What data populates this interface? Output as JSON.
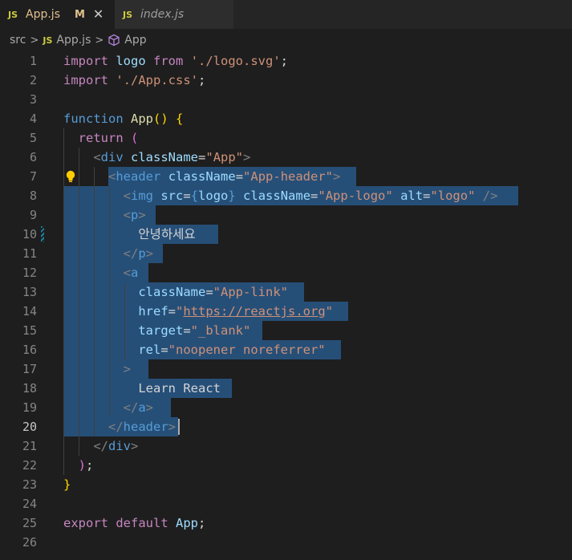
{
  "tabs": [
    {
      "icon": "JS",
      "label": "App.js",
      "modified": "M",
      "close": "✕"
    },
    {
      "icon": "JS",
      "label": "index.js"
    }
  ],
  "breadcrumb": {
    "folder": "src",
    "file_icon": "JS",
    "file": "App.js",
    "symbol": "App",
    "sep": ">"
  },
  "editor": {
    "line_numbers": [
      "1",
      "2",
      "3",
      "4",
      "5",
      "6",
      "7",
      "8",
      "9",
      "10",
      "11",
      "12",
      "13",
      "14",
      "15",
      "16",
      "17",
      "18",
      "19",
      "20",
      "21",
      "22",
      "23",
      "24",
      "25",
      "26"
    ],
    "active_line": 20,
    "korean_text": "안녕하세요",
    "link_text": "Learn React"
  },
  "colors": {
    "selection": "#264f78",
    "keyword": "#c586c0",
    "string": "#ce9178",
    "tag": "#569cd6"
  }
}
